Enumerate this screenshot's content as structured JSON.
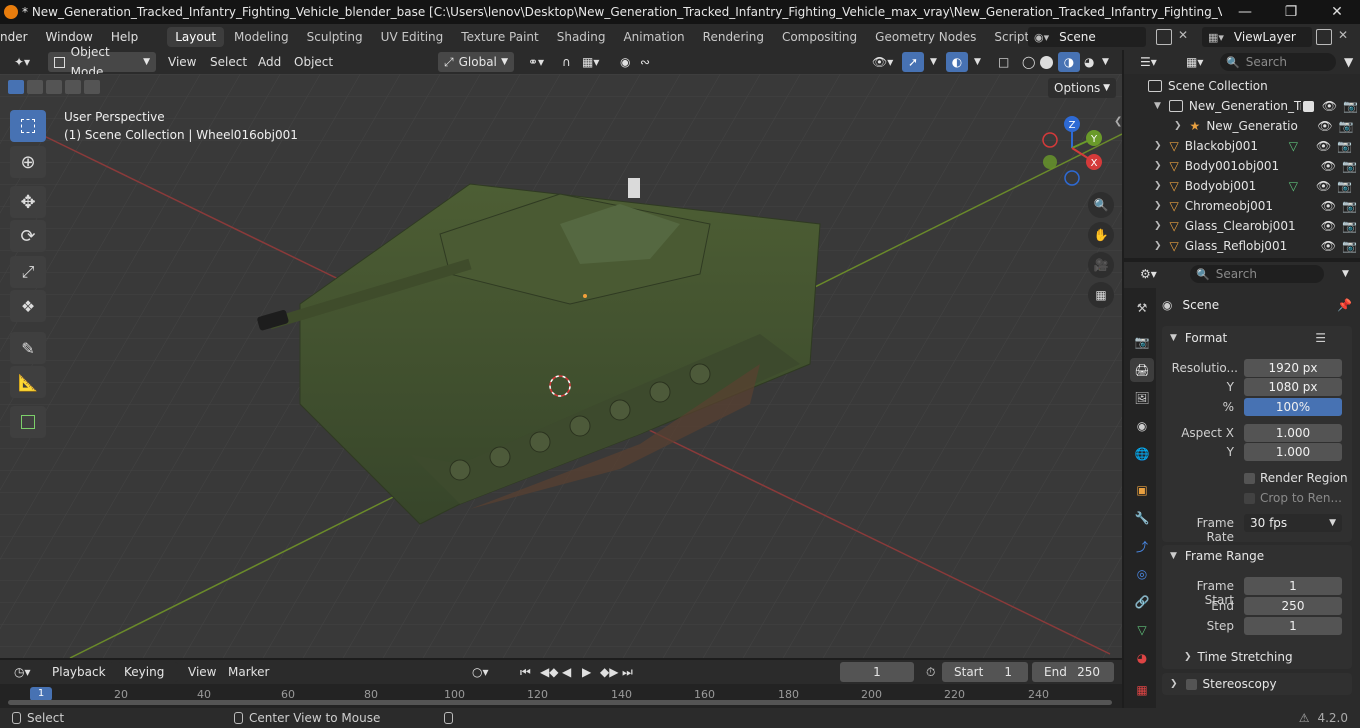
{
  "app": {
    "title": "* New_Generation_Tracked_Infantry_Fighting_Vehicle_blender_base [C:\\Users\\lenov\\Desktop\\New_Generation_Tracked_Infantry_Fighting_Vehicle_max_vray\\New_Generation_Tracked_Infantry_Fighting_Vehicle_blender_base.blen...",
    "version": "4.2.0"
  },
  "menu": {
    "items": [
      "nder",
      "Window",
      "Help"
    ]
  },
  "workspaces": {
    "tabs": [
      "Layout",
      "Modeling",
      "Sculpting",
      "UV Editing",
      "Texture Paint",
      "Shading",
      "Animation",
      "Rendering",
      "Compositing",
      "Geometry Nodes",
      "Scripting"
    ],
    "active": "Layout",
    "add": "+"
  },
  "scene_selector": {
    "label": "Scene"
  },
  "viewlayer_selector": {
    "label": "ViewLayer"
  },
  "viewport_header": {
    "mode": "Object Mode",
    "menus": [
      "View",
      "Select",
      "Add",
      "Object"
    ],
    "orientation": "Global",
    "options": "Options"
  },
  "viewport": {
    "perspective": "User Perspective",
    "collection_info": "(1) Scene Collection | Wheel016obj001",
    "gizmo_axes": {
      "x": "X",
      "y": "Y",
      "z": "Z"
    }
  },
  "outliner": {
    "search_placeholder": "Search",
    "root": "Scene Collection",
    "items": [
      {
        "label": "New_Generation_Tr",
        "kind": "collection"
      },
      {
        "label": "New_Generatio",
        "kind": "armature"
      },
      {
        "label": "Blackobj001",
        "kind": "mesh"
      },
      {
        "label": "Body001obj001",
        "kind": "mesh"
      },
      {
        "label": "Bodyobj001",
        "kind": "mesh"
      },
      {
        "label": "Chromeobj001",
        "kind": "mesh"
      },
      {
        "label": "Glass_Clearobj001",
        "kind": "mesh"
      },
      {
        "label": "Glass_Reflobj001",
        "kind": "mesh"
      }
    ]
  },
  "properties": {
    "search_placeholder": "Search",
    "context": "Scene",
    "format": {
      "title": "Format",
      "resolution_label": "Resolutio...",
      "res_x": "1920 px",
      "y_label": "Y",
      "res_y": "1080 px",
      "pct_label": "%",
      "pct": "100%",
      "aspect_label": "Aspect X",
      "aspect_x": "1.000",
      "aspect_y": "1.000",
      "render_region": "Render Region",
      "crop": "Crop to Ren...",
      "frame_rate_label": "Frame Rate",
      "frame_rate": "30 fps"
    },
    "frame_range": {
      "title": "Frame Range",
      "start_label": "Frame Start",
      "start": "1",
      "end_label": "End",
      "end": "250",
      "step_label": "Step",
      "step": "1"
    },
    "time_stretching": "Time Stretching",
    "stereoscopy": "Stereoscopy"
  },
  "timeline": {
    "menus": [
      "Playback",
      "Keying",
      "View",
      "Marker"
    ],
    "current_frame": "1",
    "start_label": "Start",
    "start": "1",
    "end_label": "End",
    "end": "250",
    "ticks": [
      "1",
      "20",
      "40",
      "60",
      "80",
      "100",
      "120",
      "140",
      "160",
      "180",
      "200",
      "220",
      "240"
    ]
  },
  "status": {
    "select": "Select",
    "center_view": "Center View to Mouse"
  }
}
